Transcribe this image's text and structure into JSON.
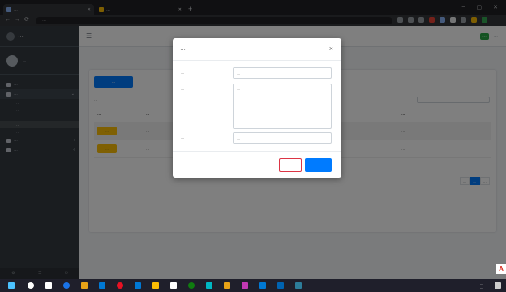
{
  "browser": {
    "tabs": [
      {
        "title": "…",
        "color": "#8ab4f8"
      },
      {
        "title": "…",
        "color": "#fbbc04"
      }
    ],
    "new_tab": "+",
    "controls": [
      "–",
      "▢",
      "✕"
    ],
    "nav": [
      "←",
      "→",
      "⟳"
    ],
    "url": "…",
    "extension_colors": [
      "#9aa0a6",
      "#9aa0a6",
      "#9aa0a6",
      "#ea4335",
      "#8ab4f8",
      "#e8eaed",
      "#9aa0a6",
      "#fbbc04",
      "#34a853"
    ]
  },
  "sidebar": {
    "brand": "…",
    "user": "…",
    "menu": [
      {
        "label": "…"
      },
      {
        "label": "…",
        "open": true,
        "sub": [
          "…",
          "…",
          "…",
          "…",
          "…"
        ],
        "active_sub": 3
      },
      {
        "label": "…"
      },
      {
        "label": "…"
      }
    ],
    "footer_icons": [
      "⚙",
      "☰",
      "⏻"
    ]
  },
  "topnav": {
    "hamburger": "☰",
    "right": [
      "…",
      "…"
    ]
  },
  "content": {
    "title": "…",
    "add_button": "…",
    "show_label": "…",
    "search_label": "…",
    "table": {
      "headers": [
        "…",
        "…",
        "…",
        "…",
        "…"
      ],
      "rows": [
        {
          "action": "…",
          "cells": [
            "…",
            "…",
            "…"
          ]
        },
        {
          "action": "…",
          "cells": [
            "…",
            "…",
            "…"
          ]
        }
      ]
    },
    "info": "…",
    "pager": [
      "…",
      "…",
      "…"
    ]
  },
  "modal": {
    "title": "…",
    "close": "×",
    "fields": [
      {
        "label": "…",
        "placeholder": "…",
        "type": "input"
      },
      {
        "label": "…",
        "placeholder": "…",
        "type": "textarea"
      },
      {
        "label": "…",
        "placeholder": "…",
        "type": "input"
      }
    ],
    "btn_close": "…",
    "btn_save": "…"
  },
  "taskbar": {
    "icon_colors": [
      "#4cc2ff",
      "#ffffff",
      "#ffffff",
      "#1a73e8",
      "#e8a317",
      "#0078d4",
      "#e81123",
      "#0078d4",
      "#fbbc04",
      "#ffffff",
      "#107c10",
      "#00b7c3",
      "#e8a317",
      "#c239b3",
      "#0078d4",
      "#0063b1",
      "#2d7d9a"
    ],
    "time": "…",
    "date": "…"
  },
  "fab": "A"
}
